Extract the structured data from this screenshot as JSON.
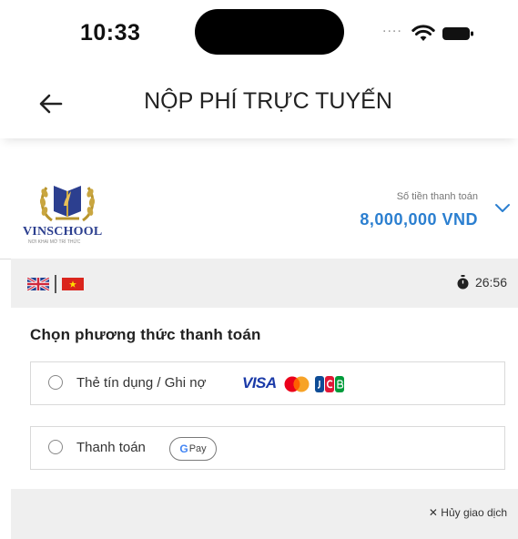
{
  "status_bar": {
    "time": "10:33",
    "signal": "....",
    "icons": [
      "wifi-icon",
      "battery-icon"
    ]
  },
  "nav": {
    "title": "NỘP PHÍ TRỰC TUYẾN",
    "back_icon": "arrow-left-icon"
  },
  "merchant": {
    "name": "VINSCHOOL",
    "tagline": "NƠI KHAI MỞ TRÍ THỨC",
    "amount_label": "Số tiền thanh toán",
    "amount_value": "8,000,000 VND",
    "expand_icon": "chevron-down-icon",
    "brand_color": "#2c3f8f",
    "amount_color": "#2b7fd0"
  },
  "language": {
    "options": [
      "English",
      "Tiếng Việt"
    ],
    "timer": "26:56"
  },
  "payment": {
    "section_title": "Chọn phương thức thanh toán",
    "methods": [
      {
        "label": "Thẻ tín dụng / Ghi nợ",
        "brands": [
          "VISA",
          "Mastercard",
          "JCB"
        ],
        "visa_text": "VISA",
        "selected": false
      },
      {
        "label": "Thanh toán",
        "badge": "G Pay",
        "selected": false
      }
    ]
  },
  "footer": {
    "cancel_label": "✕ Hủy giao dịch"
  }
}
